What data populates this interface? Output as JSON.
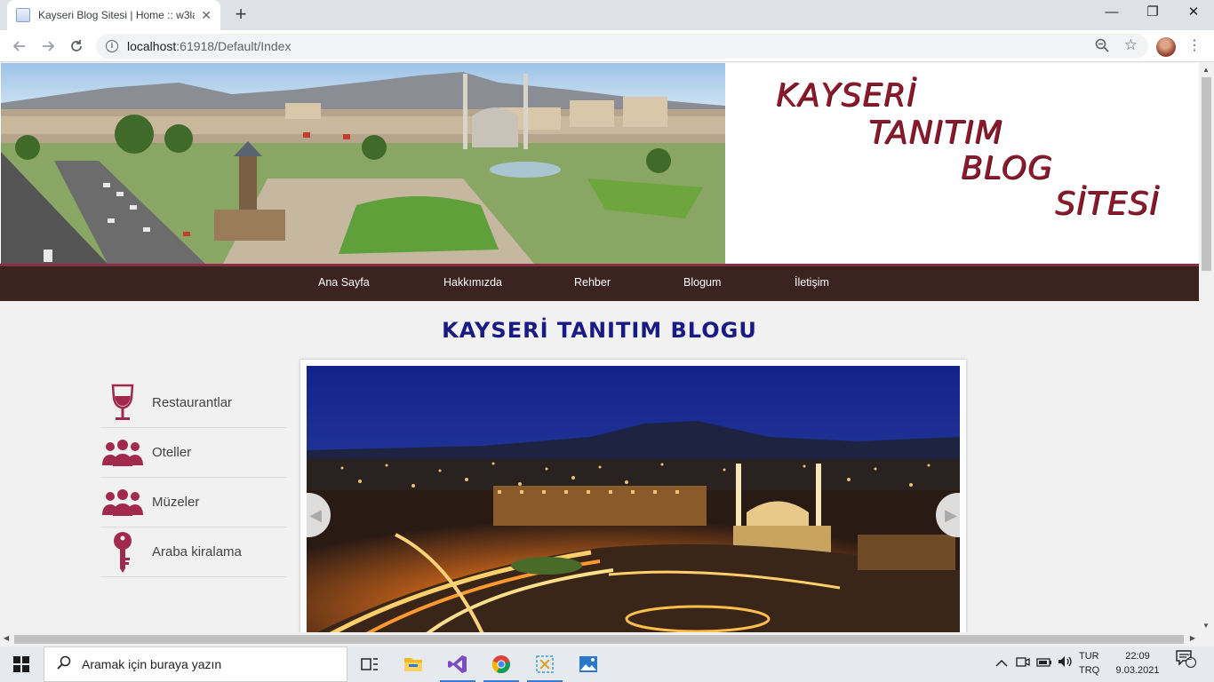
{
  "browser": {
    "tab_title": "Kayseri Blog Sitesi | Home :: w3la",
    "tab_close": "✕",
    "new_tab": "+",
    "url_host": "localhost",
    "url_rest": ":61918/Default/Index",
    "window_controls": {
      "minimize": "—",
      "restore": "❐",
      "close": "✕"
    }
  },
  "site": {
    "logo_lines": [
      "KAYSERİ",
      "TANITIM",
      "BLOG",
      "SİTESİ"
    ],
    "nav": [
      "Ana Sayfa",
      "Hakkımızda",
      "Rehber",
      "Blogum",
      "İletişim"
    ],
    "blog_title": "KAYSERİ TANITIM BLOGU",
    "sidebar": [
      {
        "label": "Restaurantlar",
        "icon": "wine-glass-icon"
      },
      {
        "label": "Oteller",
        "icon": "people-group-icon"
      },
      {
        "label": "Müzeler",
        "icon": "people-group-icon"
      },
      {
        "label": "Araba kiralama",
        "icon": "key-icon"
      }
    ],
    "accent_color": "#8b1a2c",
    "nav_bg": "#3b2420",
    "title_color": "#1a1a85"
  },
  "taskbar": {
    "search_placeholder": "Aramak için buraya yazın",
    "lang_top": "TUR",
    "lang_bottom": "TRQ",
    "time": "22:09",
    "date": "9.03.2021",
    "notification_count": "2"
  }
}
